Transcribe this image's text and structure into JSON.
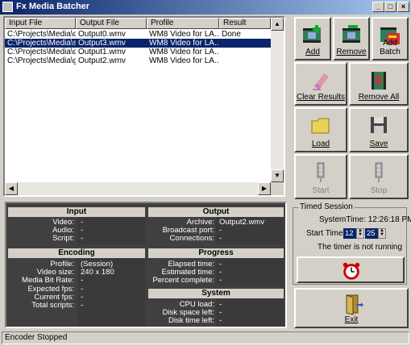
{
  "window": {
    "title": "Fx Media Batcher"
  },
  "list": {
    "columns": [
      "Input File",
      "Output File",
      "Profile",
      "Result"
    ],
    "rows": [
      [
        "C:\\Projects\\Media\\d...",
        "Output0.wmv",
        "WM8 Video for LA...",
        "Done"
      ],
      [
        "C:\\Projects\\Media\\s...",
        "Output3.wmv",
        "WM8 Video for LA...",
        ""
      ],
      [
        "C:\\Projects\\Media\\d...",
        "Output1.wmv",
        "WM8 Video for LA...",
        ""
      ],
      [
        "C:\\Projects\\Media\\g...",
        "Output2.wmv",
        "WM8 Video for LA...",
        ""
      ]
    ],
    "selected_row": 1
  },
  "buttons": {
    "add": "Add",
    "remove": "Remove",
    "add_batch": "Add Batch",
    "clear_results": "Clear Results",
    "remove_all": "Remove All",
    "load": "Load",
    "save": "Save",
    "start": "Start",
    "stop": "Stop",
    "exit": "Exit"
  },
  "panel": {
    "input": {
      "title": "Input",
      "labels": [
        "Video:",
        "Audio:",
        "Script:"
      ],
      "values": [
        "-",
        "-",
        "-"
      ]
    },
    "output": {
      "title": "Output",
      "labels": [
        "Archive:",
        "Broadcast port:",
        "Connections:"
      ],
      "values": [
        "Output2.wmv",
        "-",
        "-"
      ]
    },
    "encoding": {
      "title": "Encoding",
      "labels": [
        "Profile:",
        "Video size:",
        "Media Bit Rate:",
        "Expected fps:",
        "Current fps:",
        "Total scripts:"
      ],
      "values": [
        "(Session)",
        "240 x 180",
        "-",
        "-",
        "-",
        "-"
      ]
    },
    "progress": {
      "title": "Progress",
      "labels": [
        "Elapsed time:",
        "Estimated time:",
        "Percent complete:"
      ],
      "values": [
        "-",
        "-",
        "-"
      ]
    },
    "system": {
      "title": "System",
      "labels": [
        "CPU load:",
        "Disk space left:",
        "Disk time left:"
      ],
      "values": [
        "-",
        "-",
        "-"
      ]
    }
  },
  "timed": {
    "title": "Timed Session",
    "system_time": "SystemTime: 12:26:18 PM",
    "start_label": "Start Time:",
    "start_hour": "12",
    "start_min": "25",
    "status": "The timer is not running"
  },
  "status": "Encoder Stopped"
}
